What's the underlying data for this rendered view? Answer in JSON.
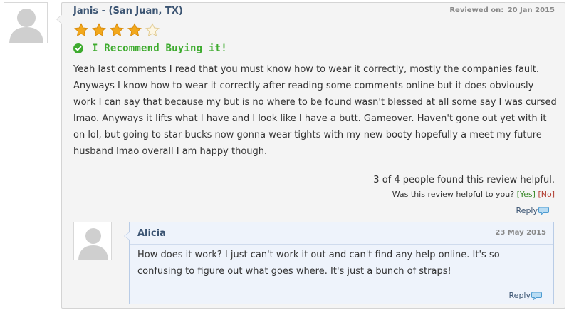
{
  "review": {
    "reviewer": "Janis - (San Juan, TX)",
    "reviewed_label": "Reviewed on:",
    "reviewed_date": "20 Jan 2015",
    "rating": 4,
    "rating_max": 5,
    "recommend_text": "I Recommend Buying it!",
    "body": "Yeah last comments I read that you must know how to wear it correctly, mostly the companies fault. Anyways I know how to wear it correctly after reading some comments online but it does obviously work I can say that because my but is no where to be found wasn't blessed at all some say I was cursed lmao. Anyways it lifts what I have and I look like I have a butt. Gameover. Haven't gone out yet with it on lol, but going to star bucks now gonna wear tights with my new booty hopefully a meet my future husband lmao overall I am happy though.",
    "helpful_count": "3 of 4 people found this review helpful.",
    "helpful_question": "Was this review helpful to you?",
    "yes_label": "[Yes]",
    "no_label": "[No]",
    "reply_label": "Reply"
  },
  "reply": {
    "author": "Alicia",
    "date": "23 May 2015",
    "body": "How does it work? I just can't work it out and can't find any help online. It's so confusing to figure out what goes where. It's just a bunch of straps!",
    "reply_label": "Reply"
  },
  "icons": {
    "avatar": "user-silhouette-icon",
    "star_filled": "star-filled-icon",
    "star_empty": "star-empty-icon",
    "check": "check-circle-icon",
    "reply": "speech-bubble-icon"
  },
  "colors": {
    "name": "#3b5472",
    "recommend": "#3eab2f",
    "star": "#f2a81c",
    "yes": "#3a8a2a",
    "no": "#b03a2e",
    "reply_bg": "#eef3fb"
  }
}
